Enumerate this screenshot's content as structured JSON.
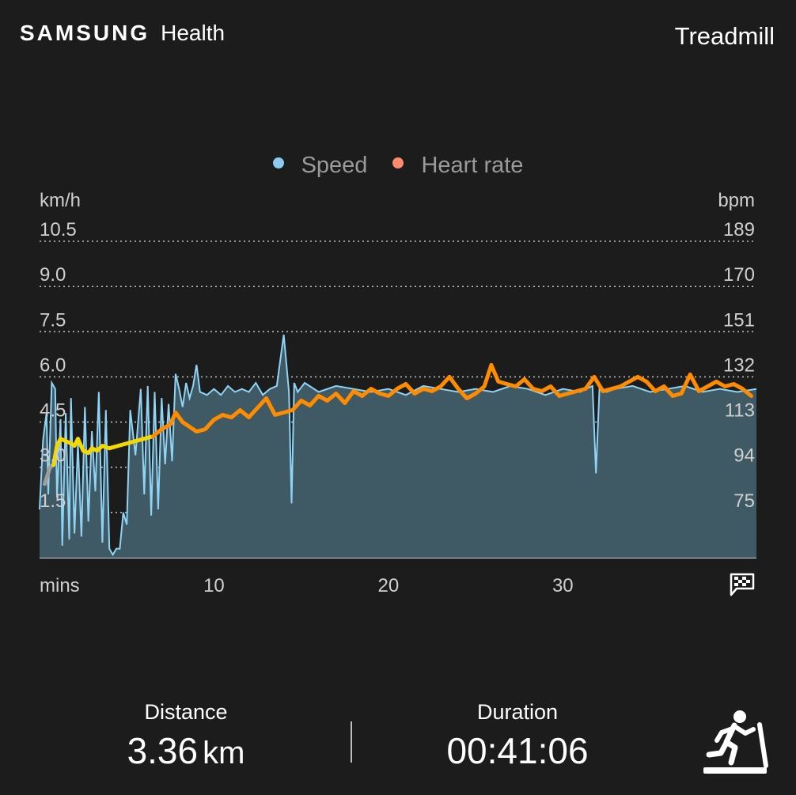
{
  "header": {
    "brand_samsung": "SAMSUNG",
    "brand_health": "Health",
    "activity": "Treadmill"
  },
  "legend": {
    "speed": "Speed",
    "heart_rate": "Heart rate"
  },
  "colors": {
    "background": "#1c1c1c",
    "speed_line": "#8fd3f5",
    "speed_fill": "#3f5a64",
    "heart_rate_orange": "#ff8c00",
    "heart_rate_yellow": "#f5d800",
    "heart_rate_gray": "#9e9e9e",
    "speed_dot": "#8ec9f0",
    "heart_dot": "#ff8a6e"
  },
  "chart_data": {
    "type": "line",
    "left_axis": {
      "unit": "km/h",
      "ticks": [
        "10.5",
        "9.0",
        "7.5",
        "6.0",
        "4.5",
        "3.0",
        "1.5"
      ],
      "range": [
        0,
        10.5
      ]
    },
    "right_axis": {
      "unit": "bpm",
      "ticks": [
        "189",
        "170",
        "151",
        "132",
        "113",
        "94",
        "75"
      ],
      "range": [
        56,
        189
      ]
    },
    "x_axis": {
      "unit": "mins",
      "ticks": [
        "10",
        "20",
        "30"
      ],
      "range": [
        0,
        41.1
      ]
    },
    "series": [
      {
        "name": "Speed",
        "axis": "left",
        "x": [
          0,
          0.2,
          0.4,
          0.5,
          0.7,
          0.9,
          1.0,
          1.2,
          1.3,
          1.5,
          1.7,
          1.8,
          2.0,
          2.2,
          2.4,
          2.6,
          2.8,
          3.0,
          3.2,
          3.4,
          3.6,
          3.8,
          4.0,
          4.2,
          4.4,
          4.6,
          4.8,
          5.0,
          5.2,
          5.5,
          5.8,
          6.0,
          6.2,
          6.4,
          6.6,
          6.8,
          7.0,
          7.2,
          7.4,
          7.6,
          7.8,
          8.0,
          8.2,
          8.4,
          8.6,
          8.8,
          9.0,
          9.2,
          9.6,
          10.0,
          10.4,
          10.8,
          11.2,
          11.6,
          12.0,
          12.4,
          12.8,
          13.2,
          13.6,
          14.0,
          14.3,
          14.45,
          14.6,
          14.8,
          15.2,
          16.0,
          17.0,
          18.0,
          19.0,
          20.0,
          21.0,
          22.0,
          23.0,
          24.0,
          25.0,
          26.0,
          27.0,
          28.0,
          29.0,
          30.0,
          31.0,
          31.7,
          31.9,
          32.1,
          32.5,
          33.0,
          34.0,
          35.0,
          36.0,
          37.0,
          38.0,
          39.0,
          40.0,
          41.1
        ],
        "values": [
          1.6,
          3.9,
          4.8,
          2.1,
          5.8,
          5.6,
          2.0,
          4.6,
          0.4,
          4.8,
          0.6,
          5.3,
          0.8,
          3.8,
          0.7,
          5.0,
          1.2,
          4.2,
          2.2,
          5.5,
          0.5,
          4.9,
          0.3,
          0.1,
          0.3,
          0.3,
          1.5,
          1.1,
          4.9,
          3.4,
          5.6,
          2.1,
          5.7,
          1.4,
          5.5,
          1.6,
          5.3,
          3.1,
          5.1,
          3.2,
          6.1,
          5.6,
          5.0,
          5.8,
          5.3,
          5.7,
          6.4,
          5.5,
          5.4,
          5.6,
          5.4,
          5.7,
          5.5,
          5.6,
          5.5,
          5.8,
          5.4,
          5.6,
          5.7,
          7.4,
          5.5,
          1.8,
          5.8,
          5.5,
          5.8,
          5.5,
          5.7,
          5.6,
          5.5,
          5.6,
          5.4,
          5.7,
          5.6,
          5.5,
          5.6,
          5.5,
          5.7,
          5.6,
          5.4,
          5.6,
          5.5,
          5.7,
          2.8,
          5.6,
          5.5,
          5.6,
          5.7,
          5.5,
          5.6,
          5.7,
          5.5,
          5.6,
          5.5,
          5.6
        ]
      },
      {
        "name": "Heart rate",
        "axis": "right",
        "x": [
          0.3,
          0.6,
          0.8,
          1.0,
          1.2,
          1.5,
          1.8,
          2.0,
          2.2,
          2.5,
          2.8,
          3.0,
          3.3,
          3.6,
          4.0,
          4.5,
          5.0,
          5.5,
          6.0,
          6.5,
          7.0,
          7.5,
          7.8,
          8.2,
          8.6,
          9.0,
          9.5,
          10.0,
          10.5,
          11.0,
          11.5,
          12.0,
          12.5,
          13.0,
          13.5,
          14.0,
          14.5,
          15.0,
          15.5,
          16.0,
          16.5,
          17.0,
          17.5,
          18.0,
          18.5,
          19.0,
          19.5,
          20.0,
          20.5,
          21.0,
          21.5,
          22.0,
          22.5,
          23.0,
          23.5,
          24.0,
          24.5,
          25.0,
          25.5,
          25.9,
          26.3,
          26.8,
          27.3,
          27.8,
          28.3,
          28.8,
          29.3,
          29.8,
          30.3,
          30.8,
          31.3,
          31.8,
          32.3,
          32.8,
          33.3,
          33.8,
          34.3,
          34.8,
          35.3,
          35.8,
          36.3,
          36.8,
          37.3,
          37.8,
          38.3,
          38.8,
          39.3,
          39.8,
          40.3,
          40.8
        ],
        "values": [
          87,
          94,
          95,
          103,
          106,
          105,
          104,
          103,
          106,
          101,
          100,
          102,
          101,
          103,
          102,
          103,
          104,
          105,
          106,
          107,
          110,
          112,
          117,
          113,
          111,
          109,
          110,
          114,
          116,
          115,
          118,
          115,
          119,
          123,
          116,
          117,
          118,
          122,
          120,
          124,
          122,
          125,
          121,
          126,
          124,
          127,
          125,
          124,
          127,
          129,
          125,
          127,
          126,
          128,
          132,
          127,
          123,
          125,
          128,
          137,
          130,
          129,
          128,
          131,
          127,
          126,
          128,
          124,
          125,
          126,
          127,
          132,
          126,
          127,
          128,
          130,
          132,
          130,
          126,
          128,
          124,
          125,
          133,
          126,
          128,
          130,
          128,
          129,
          127,
          124
        ],
        "segment_colors": [
          {
            "until_minute": 0.8,
            "color": "#9e9e9e"
          },
          {
            "until_minute": 6.5,
            "color": "#f5d800"
          },
          {
            "until_minute": 41.1,
            "color": "#ff8c00"
          }
        ]
      }
    ],
    "grid": true,
    "legend_position": "top-center"
  },
  "summary": {
    "distance_label": "Distance",
    "distance_value": "3.36",
    "distance_unit": "km",
    "duration_label": "Duration",
    "duration_value": "00:41:06"
  }
}
